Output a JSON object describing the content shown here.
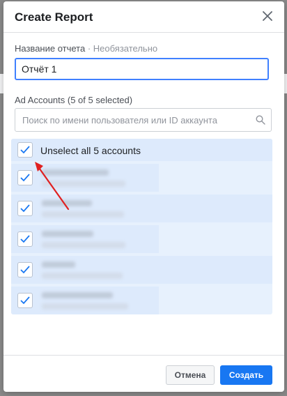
{
  "dialog": {
    "title": "Create Report",
    "close_icon": "close-icon"
  },
  "report_name": {
    "label": "Название отчета",
    "separator": " · ",
    "optional": "Необязательно",
    "value": "Отчёт 1"
  },
  "ad_accounts": {
    "label": "Ad Accounts (5 of 5 selected)",
    "search_placeholder": "Поиск по имени пользователя или ID аккаунта",
    "search_icon": "search-icon",
    "select_all_label": "Unselect all 5 accounts",
    "select_all_checked": true,
    "accounts_checked": [
      true,
      true,
      true,
      true,
      true
    ]
  },
  "footer": {
    "cancel_label": "Отмена",
    "create_label": "Создать"
  },
  "colors": {
    "primary": "#1877f2",
    "focus_border": "#4080ff",
    "list_highlight": "#e7f1fd",
    "annotation_arrow": "#e02020"
  }
}
